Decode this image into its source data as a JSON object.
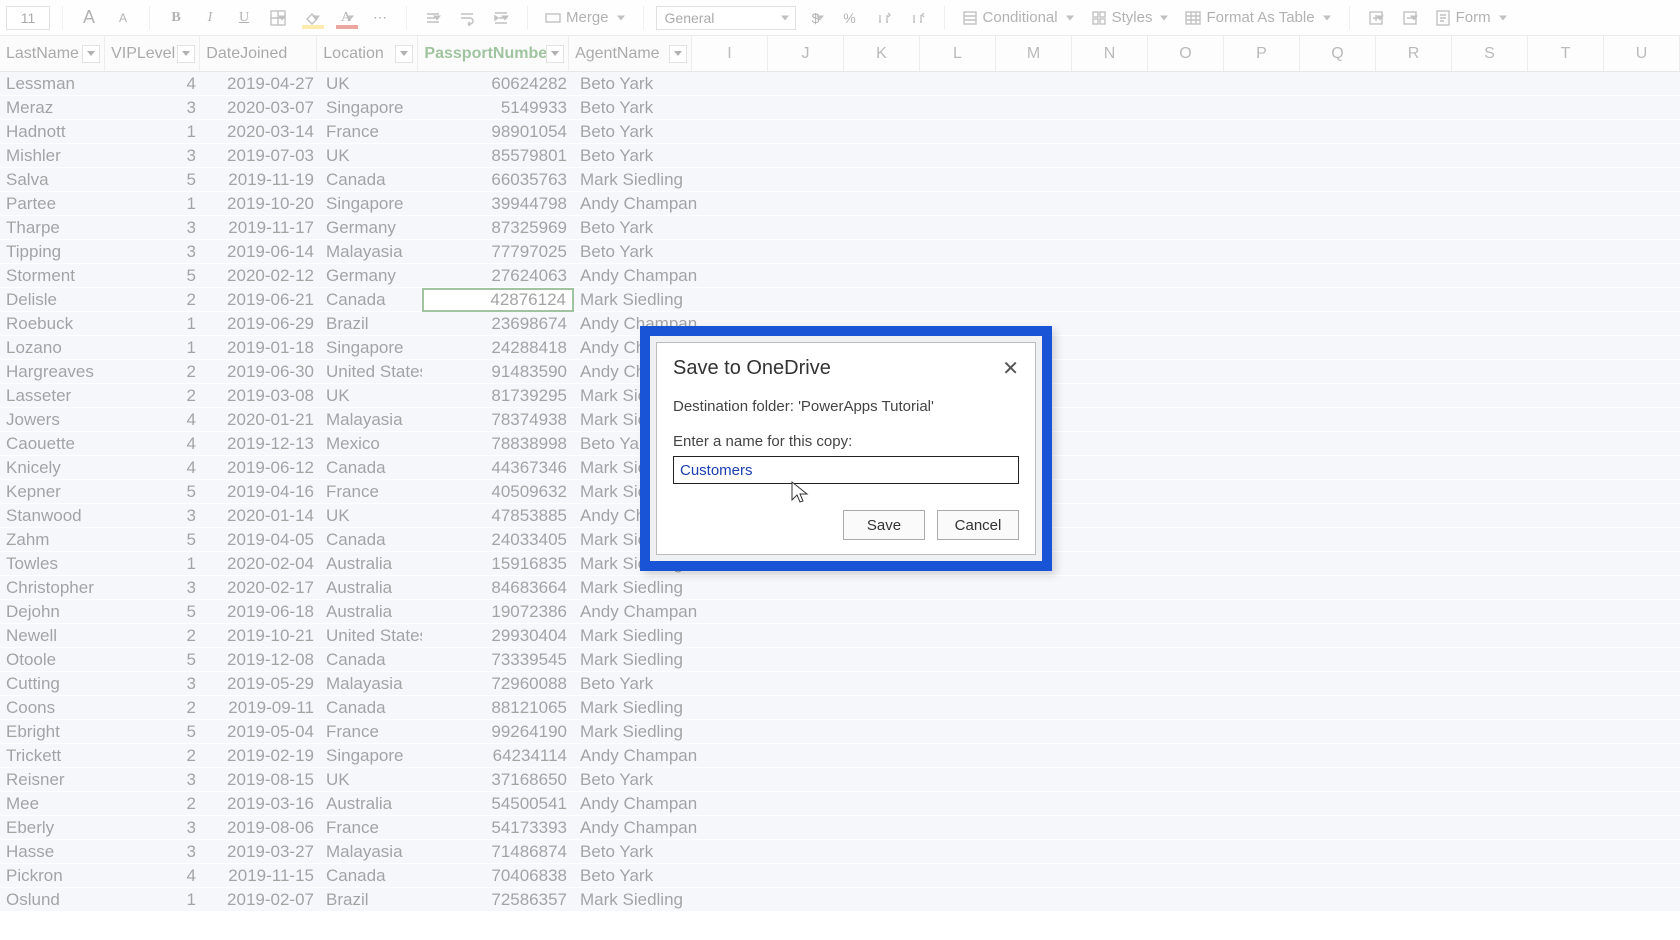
{
  "ribbon": {
    "font_size": "11",
    "merge_label": "Merge",
    "number_format": "General",
    "conditional_label": "Conditional",
    "styles_label": "Styles",
    "format_table_label": "Format As Table",
    "form_label": "Form",
    "glyph_A": "A",
    "glyph_B": "B",
    "glyph_I": "I",
    "glyph_U": "U",
    "glyph_dots": "⋯",
    "glyph_dollar": "$",
    "glyph_percent": "%"
  },
  "headers": {
    "last": "LastName",
    "vip": "VIPLevel",
    "date": "DateJoined",
    "loc": "Location",
    "pn": "PassportNumber",
    "agent": "AgentName"
  },
  "letter_cols": [
    "I",
    "J",
    "K",
    "L",
    "M",
    "N",
    "O",
    "P",
    "Q",
    "R",
    "S",
    "T",
    "U"
  ],
  "rows": [
    {
      "last": "Lessman",
      "vip": "4",
      "date": "2019-04-27",
      "loc": "UK",
      "pn": "60624282",
      "agent": "Beto Yark"
    },
    {
      "last": "Meraz",
      "vip": "3",
      "date": "2020-03-07",
      "loc": "Singapore",
      "pn": "5149933",
      "agent": "Beto Yark"
    },
    {
      "last": "Hadnott",
      "vip": "1",
      "date": "2020-03-14",
      "loc": "France",
      "pn": "98901054",
      "agent": "Beto Yark"
    },
    {
      "last": "Mishler",
      "vip": "3",
      "date": "2019-07-03",
      "loc": "UK",
      "pn": "85579801",
      "agent": "Beto Yark"
    },
    {
      "last": "Salva",
      "vip": "5",
      "date": "2019-11-19",
      "loc": "Canada",
      "pn": "66035763",
      "agent": "Mark Siedling"
    },
    {
      "last": "Partee",
      "vip": "1",
      "date": "2019-10-20",
      "loc": "Singapore",
      "pn": "39944798",
      "agent": "Andy Champan"
    },
    {
      "last": "Tharpe",
      "vip": "3",
      "date": "2019-11-17",
      "loc": "Germany",
      "pn": "87325969",
      "agent": "Beto Yark"
    },
    {
      "last": "Tipping",
      "vip": "3",
      "date": "2019-06-14",
      "loc": "Malayasia",
      "pn": "77797025",
      "agent": "Beto Yark"
    },
    {
      "last": "Storment",
      "vip": "5",
      "date": "2020-02-12",
      "loc": "Germany",
      "pn": "27624063",
      "agent": "Andy Champan"
    },
    {
      "last": "Delisle",
      "vip": "2",
      "date": "2019-06-21",
      "loc": "Canada",
      "pn": "42876124",
      "agent": "Mark Siedling",
      "selected": true
    },
    {
      "last": "Roebuck",
      "vip": "1",
      "date": "2019-06-29",
      "loc": "Brazil",
      "pn": "23698674",
      "agent": "Andy Champan"
    },
    {
      "last": "Lozano",
      "vip": "1",
      "date": "2019-01-18",
      "loc": "Singapore",
      "pn": "24288418",
      "agent": "Andy Champan"
    },
    {
      "last": "Hargreaves",
      "vip": "2",
      "date": "2019-06-30",
      "loc": "United States",
      "pn": "91483590",
      "agent": "Andy Champan"
    },
    {
      "last": "Lasseter",
      "vip": "2",
      "date": "2019-03-08",
      "loc": "UK",
      "pn": "81739295",
      "agent": "Mark Siedling"
    },
    {
      "last": "Jowers",
      "vip": "4",
      "date": "2020-01-21",
      "loc": "Malayasia",
      "pn": "78374938",
      "agent": "Mark Siedling"
    },
    {
      "last": "Caouette",
      "vip": "4",
      "date": "2019-12-13",
      "loc": "Mexico",
      "pn": "78838998",
      "agent": "Beto Yark"
    },
    {
      "last": "Knicely",
      "vip": "4",
      "date": "2019-06-12",
      "loc": "Canada",
      "pn": "44367346",
      "agent": "Mark Siedling"
    },
    {
      "last": "Kepner",
      "vip": "5",
      "date": "2019-04-16",
      "loc": "France",
      "pn": "40509632",
      "agent": "Mark Siedling"
    },
    {
      "last": "Stanwood",
      "vip": "3",
      "date": "2020-01-14",
      "loc": "UK",
      "pn": "47853885",
      "agent": "Andy Champan"
    },
    {
      "last": "Zahm",
      "vip": "5",
      "date": "2019-04-05",
      "loc": "Canada",
      "pn": "24033405",
      "agent": "Mark Siedling"
    },
    {
      "last": "Towles",
      "vip": "1",
      "date": "2020-02-04",
      "loc": "Australia",
      "pn": "15916835",
      "agent": "Mark Siedling"
    },
    {
      "last": "Christopher",
      "vip": "3",
      "date": "2020-02-17",
      "loc": "Australia",
      "pn": "84683664",
      "agent": "Mark Siedling"
    },
    {
      "last": "Dejohn",
      "vip": "5",
      "date": "2019-06-18",
      "loc": "Australia",
      "pn": "19072386",
      "agent": "Andy Champan"
    },
    {
      "last": "Newell",
      "vip": "2",
      "date": "2019-10-21",
      "loc": "United States",
      "pn": "29930404",
      "agent": "Mark Siedling"
    },
    {
      "last": "Otoole",
      "vip": "5",
      "date": "2019-12-08",
      "loc": "Canada",
      "pn": "73339545",
      "agent": "Mark Siedling"
    },
    {
      "last": "Cutting",
      "vip": "3",
      "date": "2019-05-29",
      "loc": "Malayasia",
      "pn": "72960088",
      "agent": "Beto Yark"
    },
    {
      "last": "Coons",
      "vip": "2",
      "date": "2019-09-11",
      "loc": "Canada",
      "pn": "88121065",
      "agent": "Mark Siedling"
    },
    {
      "last": "Ebright",
      "vip": "5",
      "date": "2019-05-04",
      "loc": "France",
      "pn": "99264190",
      "agent": "Mark Siedling"
    },
    {
      "last": "Trickett",
      "vip": "2",
      "date": "2019-02-19",
      "loc": "Singapore",
      "pn": "64234114",
      "agent": "Andy Champan"
    },
    {
      "last": "Reisner",
      "vip": "3",
      "date": "2019-08-15",
      "loc": "UK",
      "pn": "37168650",
      "agent": "Beto Yark"
    },
    {
      "last": "Mee",
      "vip": "2",
      "date": "2019-03-16",
      "loc": "Australia",
      "pn": "54500541",
      "agent": "Andy Champan"
    },
    {
      "last": "Eberly",
      "vip": "3",
      "date": "2019-08-06",
      "loc": "France",
      "pn": "54173393",
      "agent": "Andy Champan"
    },
    {
      "last": "Hasse",
      "vip": "3",
      "date": "2019-03-27",
      "loc": "Malayasia",
      "pn": "71486874",
      "agent": "Beto Yark"
    },
    {
      "last": "Pickron",
      "vip": "4",
      "date": "2019-11-15",
      "loc": "Canada",
      "pn": "70406838",
      "agent": "Beto Yark"
    },
    {
      "last": "Oslund",
      "vip": "1",
      "date": "2019-02-07",
      "loc": "Brazil",
      "pn": "72586357",
      "agent": "Mark Siedling"
    }
  ],
  "dialog": {
    "title": "Save to OneDrive",
    "destination_text": "Destination folder: 'PowerApps Tutorial'",
    "name_label": "Enter a name for this copy:",
    "filename_value": "Customers",
    "save_label": "Save",
    "cancel_label": "Cancel",
    "close_glyph": "✕"
  }
}
